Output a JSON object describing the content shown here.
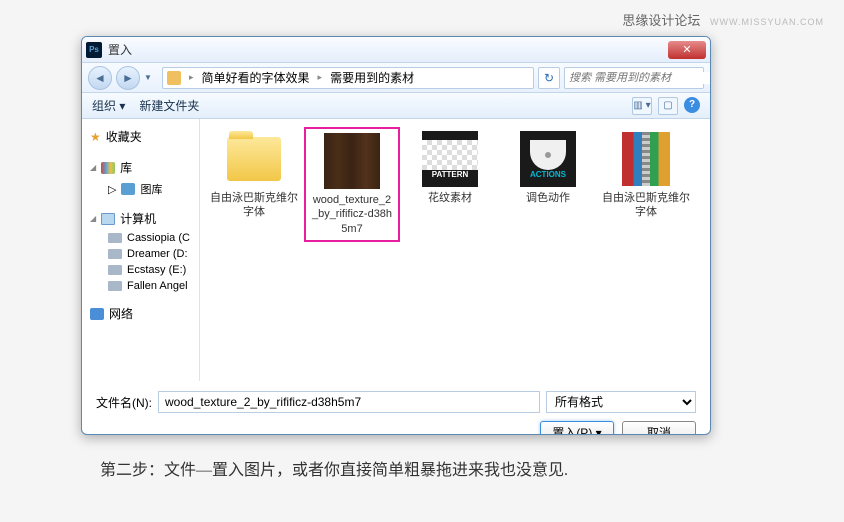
{
  "watermark": {
    "main": "思缘设计论坛",
    "sub": "WWW.MISSYUAN.COM"
  },
  "dialog": {
    "title": "置入",
    "breadcrumb": {
      "item1": "简单好看的字体效果",
      "item2": "需要用到的素材"
    },
    "search": {
      "placeholder": "搜索 需要用到的素材"
    },
    "toolbar": {
      "organize": "组织 ▾",
      "newfolder": "新建文件夹"
    },
    "sidebar": {
      "favorites": "收藏夹",
      "library": "库",
      "library_sub": "图库",
      "computer": "计算机",
      "drives": [
        "Cassiopia (C",
        "Dreamer (D:",
        "Ecstasy (E:)",
        "Fallen Angel"
      ],
      "network": "网络"
    },
    "files": [
      {
        "label": "自由泳巴斯克维尔字体"
      },
      {
        "label": "wood_texture_2_by_rifificz-d38h5m7"
      },
      {
        "label": "花纹素材"
      },
      {
        "label": "调色动作"
      },
      {
        "label": "自由泳巴斯克维尔字体"
      }
    ],
    "pattern_text": "PATTERN",
    "actions_text": "ACTIONS",
    "filename_label": "文件名(N):",
    "filename_value": "wood_texture_2_by_rifificz-d38h5m7",
    "filetype": "所有格式",
    "open_btn": "置入(P)",
    "cancel_btn": "取消"
  },
  "caption": "第二步：文件—置入图片，或者你直接简单粗暴拖进来我也没意见."
}
